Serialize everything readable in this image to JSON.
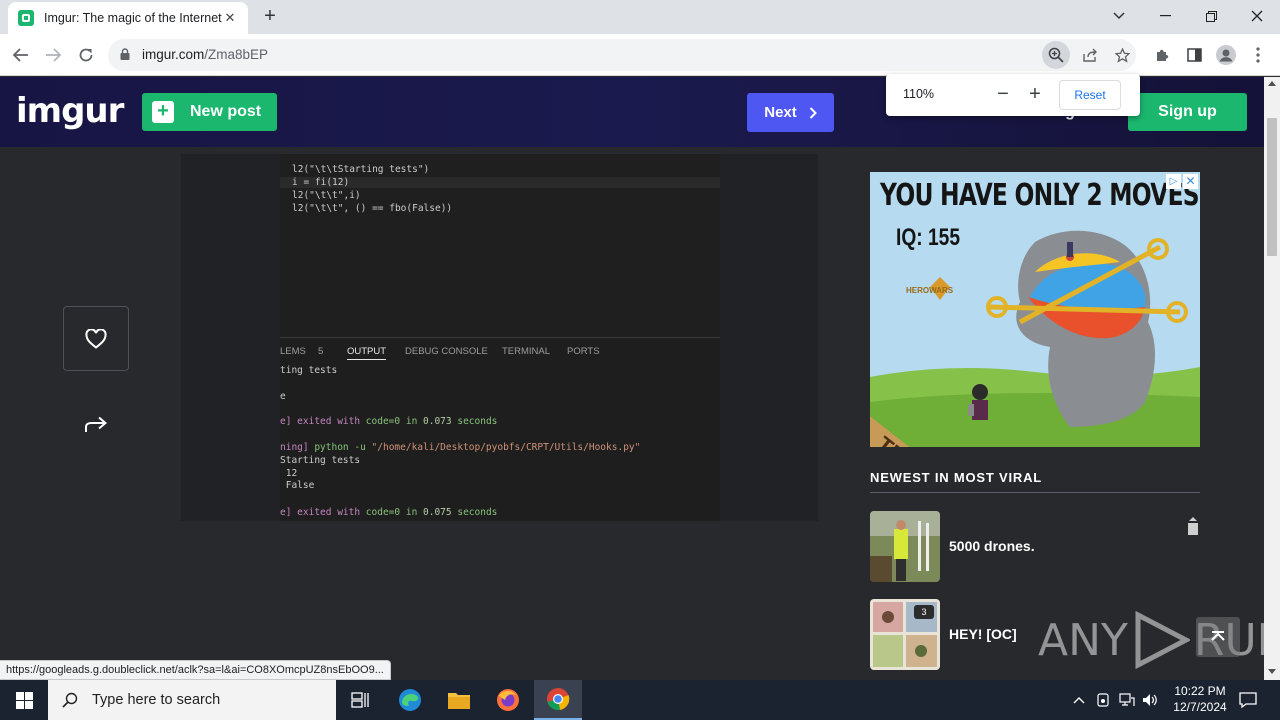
{
  "browser": {
    "tab_title": "Imgur: The magic of the Internet",
    "url_host": "imgur.com",
    "url_path": "/Zma8bEP",
    "zoom": {
      "value": "110%",
      "minus": "−",
      "plus": "+",
      "reset": "Reset"
    },
    "status_url": "https://googleads.g.doubleclick.net/aclk?sa=l&ai=CO8XOmcpUZ8nsEbOO9..."
  },
  "header": {
    "logo": "imgur",
    "new_post": "New post",
    "next": "Next",
    "sign_in": "Sign in",
    "sign_up": "Sign up"
  },
  "post_image": {
    "code": [
      "l2(\"\\t\\tStarting tests\")",
      "i = fi(12)",
      "l2(\"\\t\\t\",i)",
      "l2(\"\\t\\t\", () == fbo(False))"
    ],
    "panel_tabs": [
      "LEMS",
      "5",
      "OUTPUT",
      "DEBUG CONSOLE",
      "TERMINAL",
      "PORTS"
    ],
    "output": {
      "l1": "ting tests",
      "l2": "e",
      "l3a": "e] exited with ",
      "l3b": "code=0",
      "l3c": " in ",
      "l3d": "0.073",
      "l3e": " seconds",
      "l4a": "ning] ",
      "l4b": "python -u ",
      "l4c": "\"/home/kali/Desktop/pyobfs/CRPT/Utils/Hooks.py\"",
      "l5": "Starting tests",
      "l6": " 12",
      "l7": " False",
      "l8a": "e] exited with ",
      "l8b": "code=0",
      "l8c": " in ",
      "l8d": "0.075",
      "l8e": " seconds"
    }
  },
  "ad": {
    "headline": "YOU HAVE ONLY 2 MOVES",
    "iq": "IQ: 155",
    "brand": "HEROWARS",
    "try": "TRY"
  },
  "sidebar": {
    "section_title": "NEWEST IN MOST VIRAL",
    "items": [
      {
        "title": "5000 drones.",
        "count": ""
      },
      {
        "title": "HEY! [OC]",
        "count": "3"
      }
    ]
  },
  "watermark": {
    "text1": "ANY",
    "text2": "RUN"
  },
  "taskbar": {
    "search_placeholder": "Type here to search",
    "time": "10:22 PM",
    "date": "12/7/2024"
  },
  "colors": {
    "imgur_green": "#1bb76e",
    "next_blue": "#4f57f2",
    "page_bg": "#27292d",
    "header_bg": "#1b1a4e"
  }
}
